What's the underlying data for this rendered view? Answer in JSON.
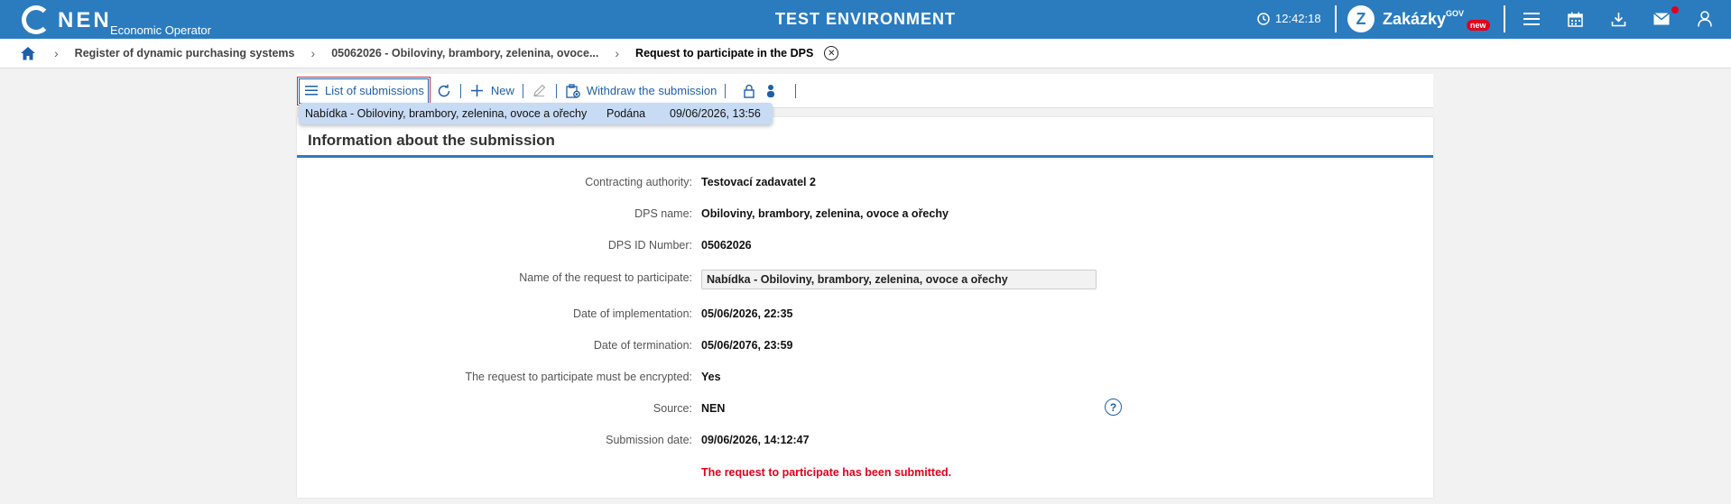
{
  "header": {
    "logo_text": "NEN",
    "logo_sub": "Economic Operator",
    "environment": "TEST ENVIRONMENT",
    "clock": "12:42:18",
    "zakazky": "Zakázky",
    "zakazky_gov": "GOV",
    "zakazky_new": "new"
  },
  "breadcrumb": {
    "items": [
      "Register of dynamic purchasing systems",
      "05062026 - Obiloviny, brambory, zelenina, ovoce...",
      "Request to participate in the DPS"
    ]
  },
  "toolbar": {
    "list_label": "List of submissions",
    "new_label": "New",
    "withdraw_label": "Withdraw the submission"
  },
  "dropdown": {
    "name": "Nabídka - Obiloviny, brambory, zelenina, ovoce a ořechy",
    "status": "Podána",
    "date": "09/06/2026, 13:56"
  },
  "card": {
    "title": "Information about the submission",
    "rows": [
      {
        "label": "Contracting authority:",
        "value": "Testovací zadavatel 2"
      },
      {
        "label": "DPS name:",
        "value": "Obiloviny, brambory, zelenina, ovoce a ořechy"
      },
      {
        "label": "DPS ID Number:",
        "value": "05062026"
      },
      {
        "label": "Name of the request to participate:",
        "value": "Nabídka - Obiloviny, brambory, zelenina, ovoce a ořechy"
      },
      {
        "label": "Date of implementation:",
        "value": "05/06/2026, 22:35"
      },
      {
        "label": "Date of termination:",
        "value": "05/06/2076, 23:59"
      },
      {
        "label": "The request to participate must be encrypted:",
        "value": "Yes"
      },
      {
        "label": "Source:",
        "value": "NEN"
      },
      {
        "label": "Submission date:",
        "value": "09/06/2026, 14:12:47"
      }
    ],
    "status_message": "The request to participate has been submitted."
  },
  "colors": {
    "brand_blue": "#2b7cbf",
    "alert_red": "#e3001b"
  }
}
